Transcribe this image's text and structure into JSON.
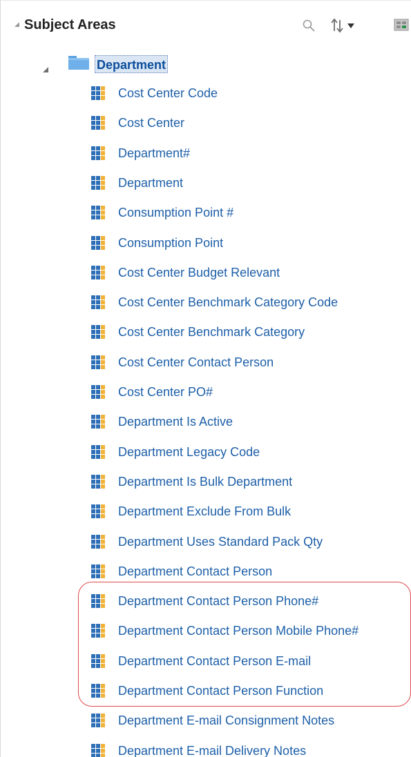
{
  "panel": {
    "title": "Subject Areas",
    "toolbar_icons": [
      "search-icon",
      "sort-icon",
      "sort-menu-chevron-icon",
      "toolbar-options-icon"
    ]
  },
  "tree": {
    "root": {
      "label": "Department",
      "icon": "folder-icon",
      "expanded": true
    },
    "items": [
      {
        "label": "Cost Center Code"
      },
      {
        "label": "Cost Center"
      },
      {
        "label": "Department#"
      },
      {
        "label": "Department"
      },
      {
        "label": "Consumption Point #"
      },
      {
        "label": "Consumption Point"
      },
      {
        "label": "Cost Center Budget Relevant"
      },
      {
        "label": "Cost Center Benchmark Category Code"
      },
      {
        "label": "Cost Center Benchmark Category"
      },
      {
        "label": "Cost Center Contact Person"
      },
      {
        "label": "Cost Center PO#"
      },
      {
        "label": "Department Is Active"
      },
      {
        "label": "Department Legacy Code"
      },
      {
        "label": "Department Is Bulk Department"
      },
      {
        "label": "Department Exclude From Bulk"
      },
      {
        "label": "Department Uses Standard Pack Qty"
      },
      {
        "label": "Department Contact Person"
      },
      {
        "label": "Department Contact Person Phone#"
      },
      {
        "label": "Department Contact Person Mobile Phone#"
      },
      {
        "label": "Department Contact Person E-mail"
      },
      {
        "label": "Department Contact Person Function"
      },
      {
        "label": "Department E-mail Consignment Notes"
      },
      {
        "label": "Department E-mail Delivery Notes"
      }
    ]
  },
  "colors": {
    "item_text": "#1d5fa8",
    "root_text": "#0a4e9b",
    "highlight": "#e0474c",
    "column_icon": "#2f6fb6"
  }
}
